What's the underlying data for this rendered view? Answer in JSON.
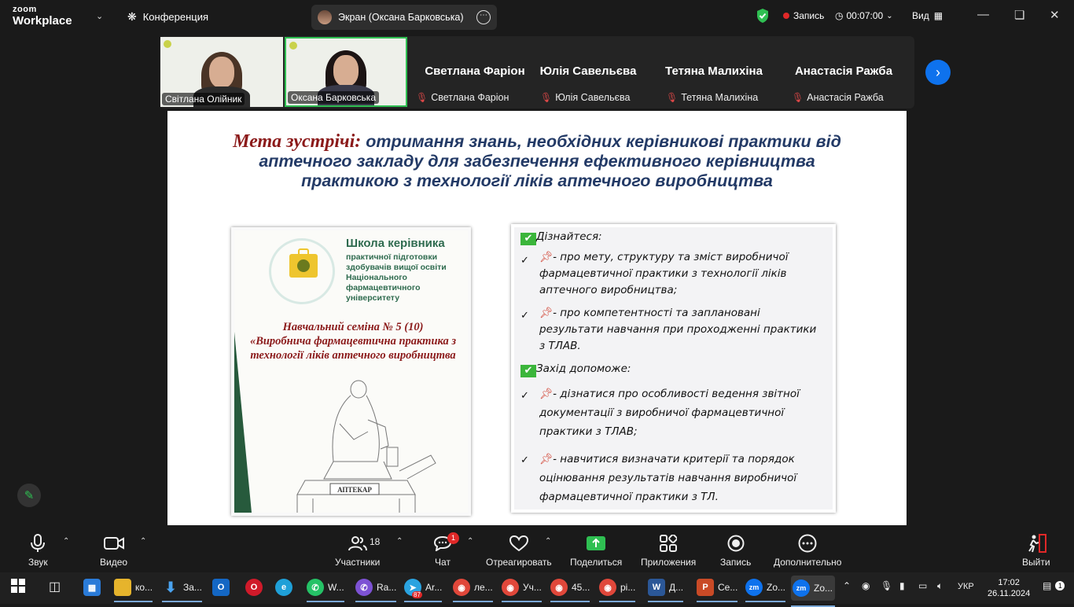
{
  "app": {
    "brand_top": "zoom",
    "brand_bottom": "Workplace",
    "meeting_title": "Конференция",
    "screen_share_label": "Экран (Оксана Барковська)",
    "record_label": "Запись",
    "timer": "00:07:00",
    "view_label": "Вид"
  },
  "participants": {
    "video_tiles": [
      {
        "name": "Світлана Олійник"
      },
      {
        "name": "Оксана Барковська"
      }
    ],
    "name_tiles": [
      {
        "display": "Светлана Фаріон",
        "label": "Светлана Фаріон"
      },
      {
        "display": "Юлія Савельєва",
        "label": "Юлія Савельєва"
      },
      {
        "display": "Тетяна Малихіна",
        "label": "Тетяна Малихіна"
      },
      {
        "display": "Анастасія Ражба",
        "label": "Анастасія Ражба"
      }
    ]
  },
  "slide": {
    "title_lead": "Мета зустрічі:",
    "title_rest": " отримання знань, необхідних керівникові практики від аптечного закладу для забезпечення ефективного керівництва практикою з технології ліків аптечного виробництва",
    "left_card": {
      "school_title": "Школа керівника",
      "school_subtitle": "практичної підготовки здобувачів вищої освіти Національного фармацевтичного університету",
      "seminar_line1": "Навчальний семіна  № 5 (10)",
      "seminar_line2": "«Виробнича фармацевтична практика з технології ліків аптечного виробництва",
      "statue_sign": "АПТЕКАР"
    },
    "right_card": {
      "heading1": "Дізнайтеся:",
      "item1": "- про мету, структуру та зміст виробничої фармацевтичної практики з технології ліків аптечного виробництва;",
      "item2": "- про компетентності та заплановані результати навчання при проходженні практики з ТЛАВ.",
      "heading2": "Захід допоможе:",
      "item3": "- дізнатися про особливості ведення звітної документації з виробничої фармацевтичної практики з ТЛАВ;",
      "item4": "- навчитися визначати критерії та порядок оцінювання результатів навчання виробничої фармацевтичної практики з ТЛ."
    }
  },
  "toolbar": {
    "audio": "Звук",
    "video": "Видео",
    "participants": "Участники",
    "participants_count": "18",
    "chat": "Чат",
    "chat_badge": "1",
    "react": "Отреагировать",
    "share": "Поделиться",
    "apps": "Приложения",
    "record": "Запись",
    "more": "Дополнительно",
    "leave": "Выйти"
  },
  "taskbar": {
    "items": [
      {
        "label": "ко..."
      },
      {
        "label": "За..."
      },
      {
        "label": "W..."
      },
      {
        "label": "Ra..."
      },
      {
        "label": "Ar..."
      },
      {
        "label": "ле..."
      },
      {
        "label": "Уч..."
      },
      {
        "label": "45..."
      },
      {
        "label": "рі..."
      },
      {
        "label": "Д..."
      },
      {
        "label": "Се..."
      },
      {
        "label": "Zo..."
      },
      {
        "label": "Zo..."
      }
    ],
    "telegram_badge": "87",
    "lang": "УКР",
    "time": "17:02",
    "date": "26.11.2024",
    "notif_count": "1"
  },
  "colors": {
    "zoom_blue": "#0e72ed",
    "record_red": "#e02828",
    "active_green": "#2fbf52",
    "slide_title_blue": "#233a66",
    "slide_title_red": "#8b1a1a"
  }
}
